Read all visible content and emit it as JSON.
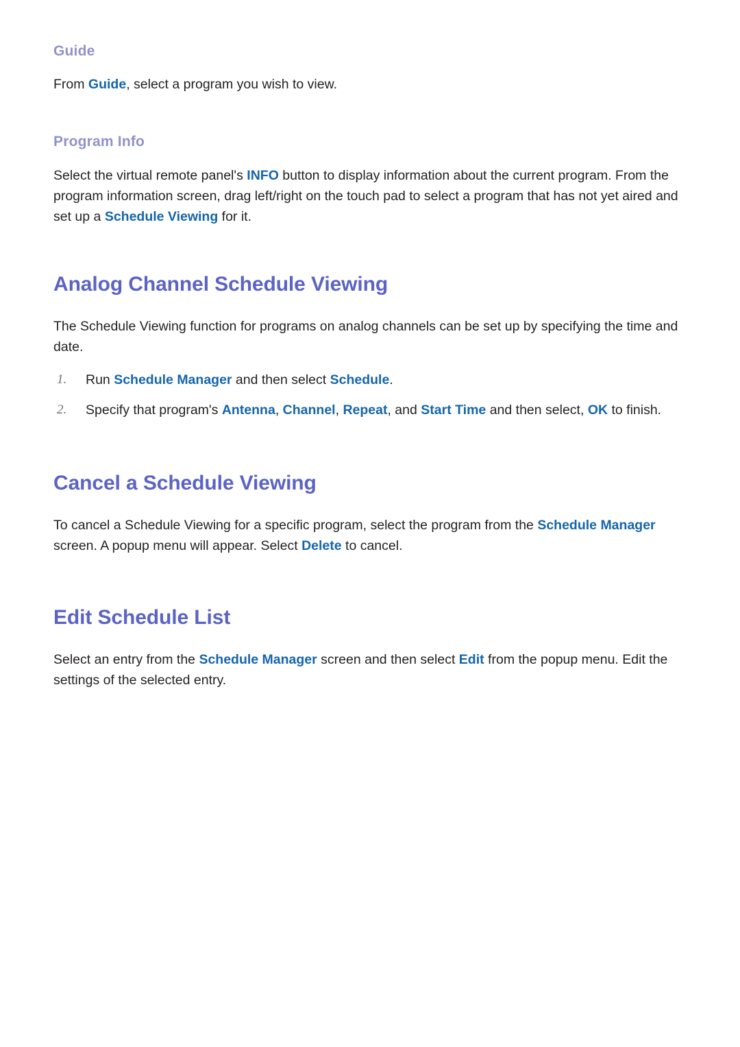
{
  "document": {
    "type": "e-manual-page",
    "colors": {
      "subheading": "#8f93c7",
      "heading": "#5b63c4",
      "highlight": "#1565ab",
      "body_text": "#231f20",
      "list_number": "#6d6e71",
      "background": "#ffffff"
    }
  },
  "sections": {
    "guide": {
      "subheading": "Guide",
      "paragraph": {
        "part1": "From ",
        "link1": "Guide",
        "part2": ", select a program you wish to view."
      }
    },
    "program_info": {
      "subheading": "Program Info",
      "paragraph": {
        "part1": "Select the virtual remote panel's ",
        "link1": "INFO",
        "part2": " button to display information about the current program. From the program information screen, drag left/right on the touch pad to select a program that has not yet aired and set up a ",
        "link2": "Schedule Viewing",
        "part3": " for it."
      }
    },
    "analog_channel": {
      "heading": "Analog Channel Schedule Viewing",
      "paragraph": "The Schedule Viewing function for programs on analog channels can be set up by specifying the time and date.",
      "steps": [
        {
          "number": "1.",
          "part1": "Run ",
          "link1": "Schedule Manager",
          "part2": " and then select ",
          "link2": "Schedule",
          "part3": "."
        },
        {
          "number": "2.",
          "part1": "Specify that program's ",
          "link1": "Antenna",
          "part2": ", ",
          "link2": "Channel",
          "part3": ", ",
          "link3": "Repeat",
          "part4": ", and ",
          "link4": "Start Time",
          "part5": " and then select, ",
          "link5": "OK",
          "part6": " to finish."
        }
      ]
    },
    "cancel_schedule": {
      "heading": "Cancel a Schedule Viewing",
      "paragraph": {
        "part1": "To cancel a Schedule Viewing for a specific program, select the program from the ",
        "link1": "Schedule Manager",
        "part2": " screen. A popup menu will appear. Select ",
        "link2": "Delete",
        "part3": " to cancel."
      }
    },
    "edit_schedule": {
      "heading": "Edit Schedule List",
      "paragraph": {
        "part1": "Select an entry from the ",
        "link1": "Schedule Manager",
        "part2": " screen and then select ",
        "link2": "Edit",
        "part3": " from the popup menu. Edit the settings of the selected entry."
      }
    }
  }
}
